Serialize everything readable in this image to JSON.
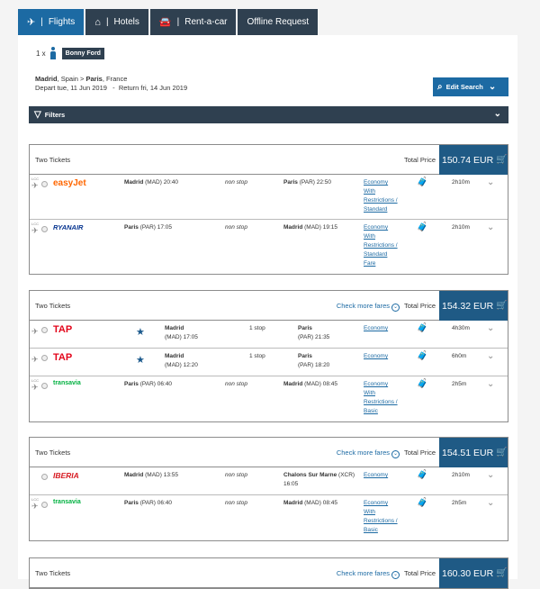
{
  "tabs": [
    {
      "label": "Flights",
      "icon": "plane-icon"
    },
    {
      "label": "Hotels",
      "icon": "home-icon"
    },
    {
      "label": "Rent-a-car",
      "icon": "car-icon"
    },
    {
      "label": "Offline Request",
      "icon": ""
    }
  ],
  "tab_separator": "|",
  "passenger": {
    "count": "1 x",
    "name": "Bonny Ford"
  },
  "search": {
    "origin": "Madrid",
    "origin_rest": ", Spain > ",
    "destination": "Paris",
    "destination_rest": ", France",
    "dates": "Depart tue, 11 Jun 2019   -  Return fri, 14 Jun 2019",
    "edit_label": "Edit Search"
  },
  "filters_label": "Filters",
  "cards": [
    {
      "label": "Two Tickets",
      "more": "",
      "total_label": "Total Price",
      "price": "150.74 EUR",
      "segments": [
        {
          "lcc": "LCC",
          "airline": "easyJet",
          "from_city": "Madrid",
          "from_code": "(MAD)",
          "dep": "20:40",
          "stops": "non stop",
          "to_city": "Paris",
          "to_code": "(PAR)",
          "arr": "22:50",
          "fare": [
            "Economy",
            "With",
            "Restrictions /",
            "Standard"
          ],
          "duration": "2h10m"
        },
        {
          "lcc": "LCC",
          "airline": "RYANAIR",
          "from_city": "Paris",
          "from_code": "(PAR)",
          "dep": "17:05",
          "stops": "non stop",
          "to_city": "Madrid",
          "to_code": "(MAD)",
          "arr": "19:15",
          "fare": [
            "Economy",
            "With",
            "Restrictions /",
            "Standard",
            "Fare"
          ],
          "duration": "2h10m"
        }
      ]
    },
    {
      "label": "Two Tickets",
      "more": "Check more fares",
      "total_label": "Total Price",
      "price": "154.32 EUR",
      "segments": [
        {
          "lcc": "",
          "airline": "TAP",
          "from_city": "Madrid",
          "from_code": "(MAD)",
          "dep": "17:05",
          "stops": "1 stop",
          "to_city": "Paris",
          "to_code": "(PAR)",
          "arr": "21:35",
          "fare": [
            "Economy"
          ],
          "duration": "4h30m"
        },
        {
          "lcc": "",
          "airline": "TAP",
          "from_city": "Madrid",
          "from_code": "(MAD)",
          "dep": "12:20",
          "stops": "1 stop",
          "to_city": "Paris",
          "to_code": "(PAR)",
          "arr": "18:20",
          "fare": [
            "Economy"
          ],
          "duration": "6h0m"
        },
        {
          "lcc": "LCC",
          "airline": "transavia",
          "from_city": "Paris",
          "from_code": "(PAR)",
          "dep": "06:40",
          "stops": "non stop",
          "to_city": "Madrid",
          "to_code": "(MAD)",
          "arr": "08:45",
          "fare": [
            "Economy",
            "With",
            "Restrictions /",
            "Basic"
          ],
          "duration": "2h5m"
        }
      ]
    },
    {
      "label": "Two Tickets",
      "more": "Check more fares",
      "total_label": "Total Price",
      "price": "154.51 EUR",
      "segments": [
        {
          "lcc": "",
          "airline": "IBERIA",
          "from_city": "Madrid",
          "from_code": "(MAD)",
          "dep": "13:55",
          "stops": "non stop",
          "to_city": "Chalons Sur Marne",
          "to_code": "(XCR)",
          "arr": "16:05",
          "fare": [
            "Economy"
          ],
          "duration": "2h10m"
        },
        {
          "lcc": "LCC",
          "airline": "transavia",
          "from_city": "Paris",
          "from_code": "(PAR)",
          "dep": "06:40",
          "stops": "non stop",
          "to_city": "Madrid",
          "to_code": "(MAD)",
          "arr": "08:45",
          "fare": [
            "Economy",
            "With",
            "Restrictions /",
            "Basic"
          ],
          "duration": "2h5m"
        }
      ]
    },
    {
      "label": "Two Tickets",
      "more": "Check more fares",
      "total_label": "Total Price",
      "price": "160.30 EUR",
      "segments": []
    }
  ],
  "colors": {
    "nav": "#2f4050",
    "active_tab": "#1c6aa3",
    "price_bg": "#1f5a85",
    "link": "#1c6aa3"
  }
}
